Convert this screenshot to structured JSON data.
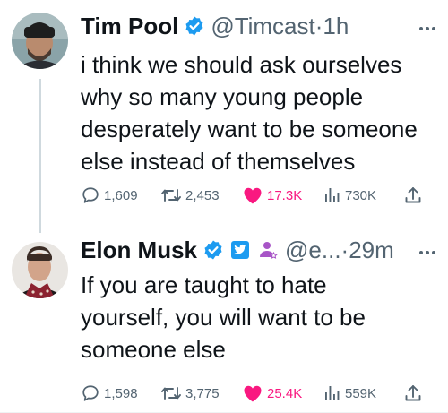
{
  "colors": {
    "text_primary": "#0f1419",
    "text_secondary": "#536471",
    "verified_blue": "#1d9bf0",
    "like_pink": "#f91880",
    "thread_line": "#cfd9de"
  },
  "tweets": [
    {
      "author_name": "Tim Pool",
      "handle": "@Timcast",
      "separator": "·",
      "time": "1h",
      "text": "i think we should ask ourselves\nwhy so many young people\ndesperately want to be someone\nelse instead of themselves",
      "icons": [
        "verified-badge-icon",
        "more-options-icon"
      ],
      "stats": {
        "replies": "1,609",
        "retweets": "2,453",
        "likes": "17.3K",
        "views": "730K"
      }
    },
    {
      "author_name": "Elon Musk",
      "handle": "@e...",
      "separator": "·",
      "time": "29m",
      "text": "If you are taught to hate\nyourself, you will want to be\nsomeone else",
      "icons": [
        "verified-badge-icon",
        "affiliate-badge-icon",
        "subscriber-badge-icon",
        "more-options-icon"
      ],
      "stats": {
        "replies": "1,598",
        "retweets": "3,775",
        "likes": "25.4K",
        "views": "559K"
      }
    }
  ]
}
